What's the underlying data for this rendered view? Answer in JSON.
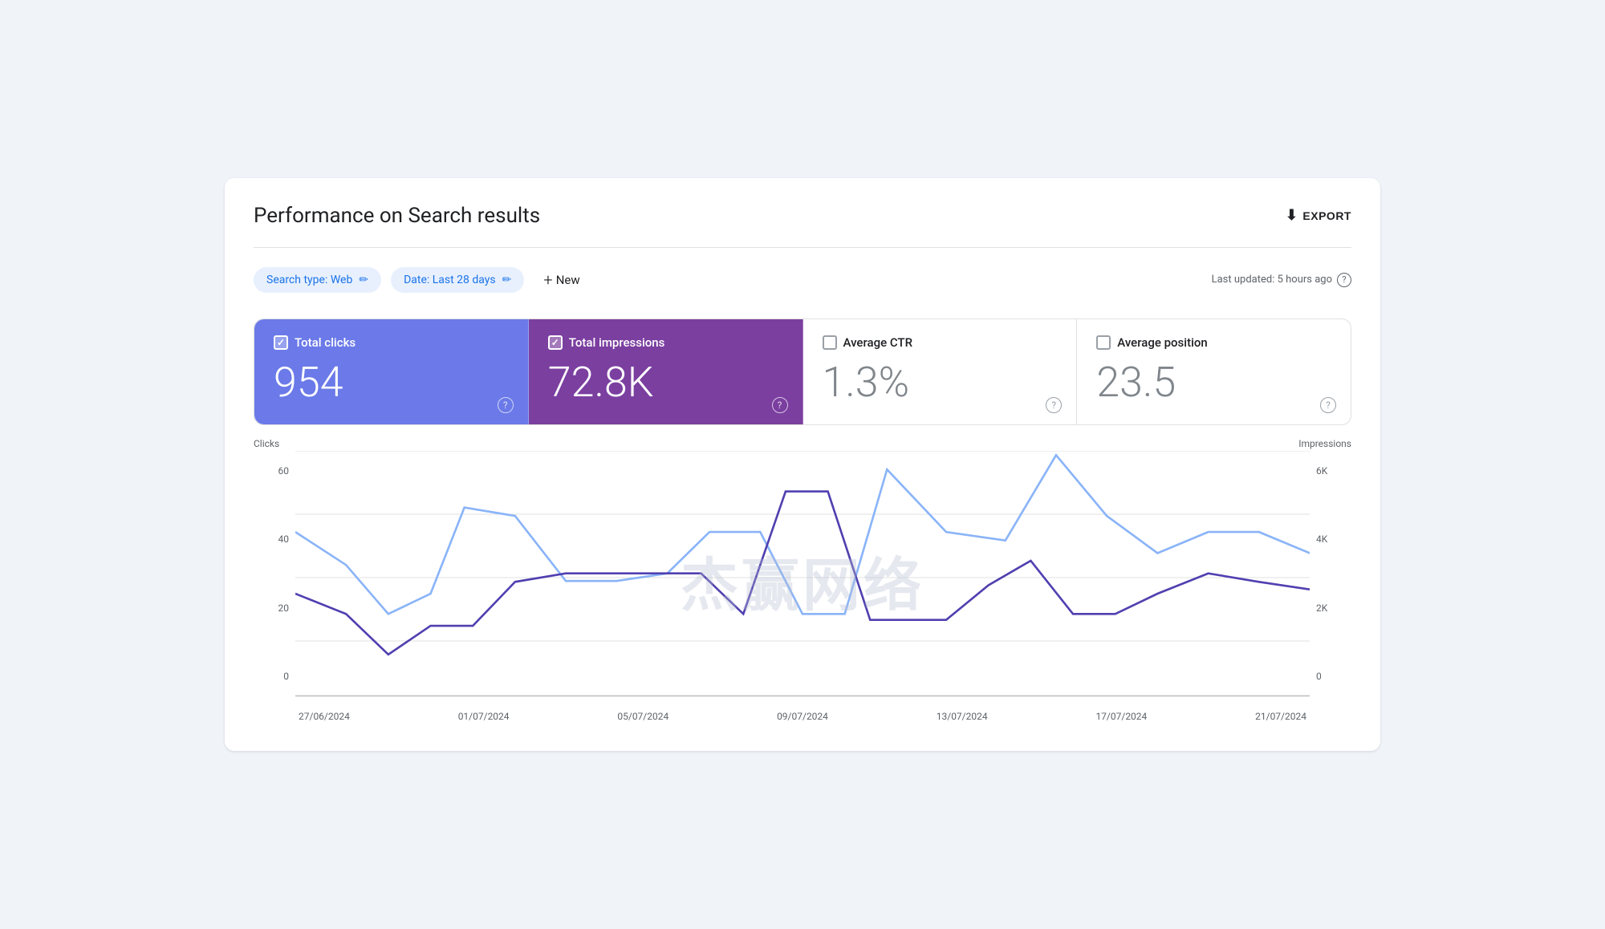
{
  "header": {
    "title": "Performance on Search results",
    "export_label": "EXPORT"
  },
  "filters": {
    "search_type_label": "Search type: Web",
    "date_label": "Date: Last 28 days",
    "new_label": "New",
    "last_updated": "Last updated: 5 hours ago"
  },
  "metrics": {
    "clicks": {
      "label": "Total clicks",
      "value": "954",
      "checked": true
    },
    "impressions": {
      "label": "Total impressions",
      "value": "72.8K",
      "checked": true
    },
    "ctr": {
      "label": "Average CTR",
      "value": "1.3%",
      "checked": false
    },
    "position": {
      "label": "Average position",
      "value": "23.5",
      "checked": false
    }
  },
  "chart": {
    "y_axis_left_title": "Clicks",
    "y_axis_right_title": "Impressions",
    "y_labels_left": [
      "60",
      "40",
      "20",
      "0"
    ],
    "y_labels_right": [
      "6K",
      "4K",
      "2K",
      "0"
    ],
    "x_labels": [
      "27/06/2024",
      "01/07/2024",
      "05/07/2024",
      "09/07/2024",
      "13/07/2024",
      "17/07/2024",
      "21/07/2024"
    ]
  },
  "watermark": "杰赢网络"
}
